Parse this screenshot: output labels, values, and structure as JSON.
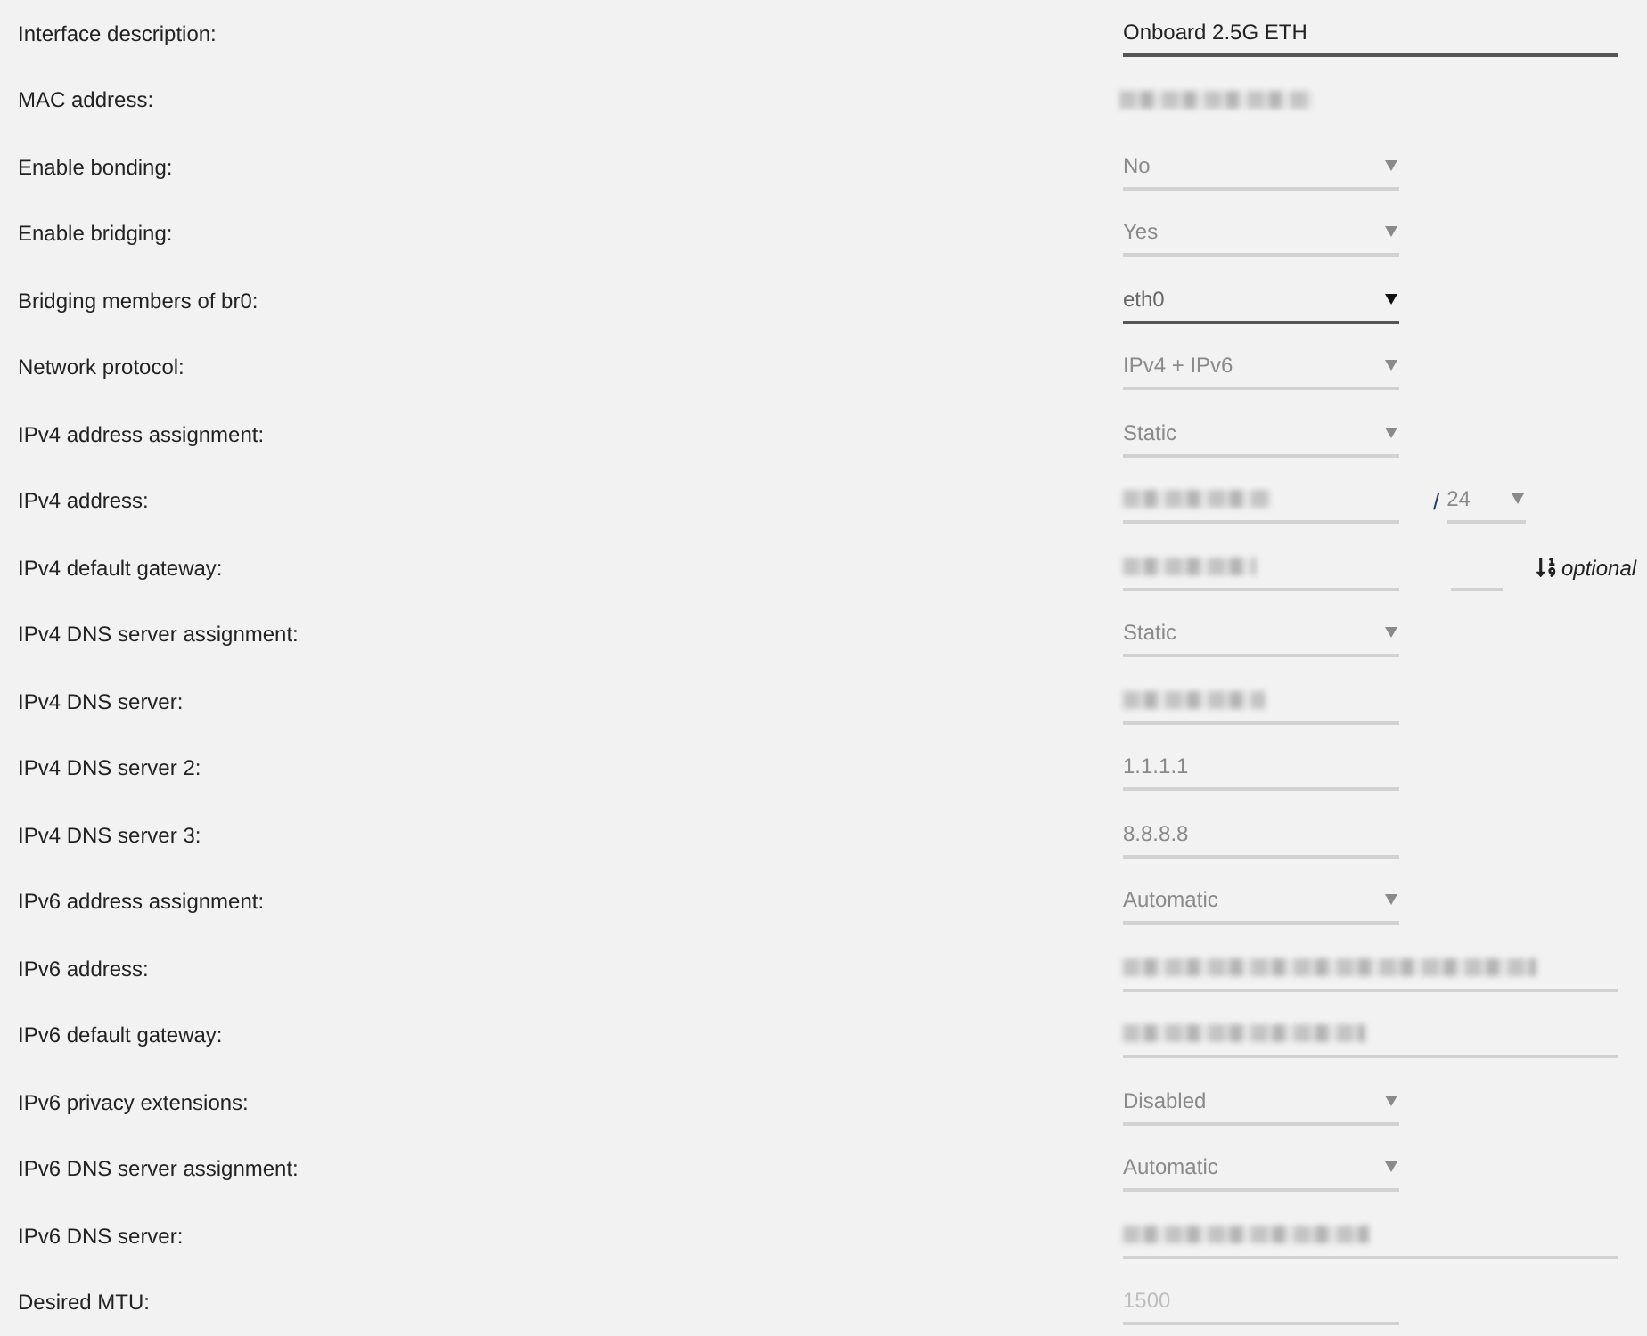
{
  "fields": [
    {
      "label": "Interface description:",
      "kind": "text",
      "value": "Onboard 2.5G ETH",
      "disabled": false,
      "wide": true
    },
    {
      "label": "MAC address:",
      "kind": "static",
      "blurred": true
    },
    {
      "label": "Enable bonding:",
      "kind": "select",
      "value": "No",
      "disabled": true
    },
    {
      "label": "Enable bridging:",
      "kind": "select",
      "value": "Yes",
      "disabled": true
    },
    {
      "label": "Bridging members of br0:",
      "kind": "select",
      "value": "eth0",
      "disabled": false
    },
    {
      "label": "Network protocol:",
      "kind": "select",
      "value": "IPv4 + IPv6",
      "disabled": true
    },
    {
      "label": "IPv4 address assignment:",
      "kind": "select",
      "value": "Static",
      "disabled": true
    },
    {
      "label": "IPv4 address:",
      "kind": "text",
      "blurred": true,
      "disabled": true,
      "prefix": {
        "separator": "/",
        "value": "24",
        "disabled": true
      }
    },
    {
      "label": "IPv4 default gateway:",
      "kind": "text",
      "blurred": true,
      "disabled": true,
      "metric": {
        "disabled": true,
        "hint": "optional"
      }
    },
    {
      "label": "IPv4 DNS server assignment:",
      "kind": "select",
      "value": "Static",
      "disabled": true
    },
    {
      "label": "IPv4 DNS server:",
      "kind": "text",
      "blurred": true,
      "disabled": true
    },
    {
      "label": "IPv4 DNS server 2:",
      "kind": "text",
      "value": "1.1.1.1",
      "disabled": true
    },
    {
      "label": "IPv4 DNS server 3:",
      "kind": "text",
      "value": "8.8.8.8",
      "disabled": true
    },
    {
      "label": "IPv6 address assignment:",
      "kind": "select",
      "value": "Automatic",
      "disabled": true
    },
    {
      "label": "IPv6 address:",
      "kind": "text",
      "blurred": true,
      "disabled": true,
      "wide": true
    },
    {
      "label": "IPv6 default gateway:",
      "kind": "text",
      "blurred": true,
      "disabled": true,
      "wide": true
    },
    {
      "label": "IPv6 privacy extensions:",
      "kind": "select",
      "value": "Disabled",
      "disabled": true
    },
    {
      "label": "IPv6 DNS server assignment:",
      "kind": "select",
      "value": "Automatic",
      "disabled": true
    },
    {
      "label": "IPv6 DNS server:",
      "kind": "text",
      "blurred": true,
      "disabled": true,
      "wide": true
    },
    {
      "label": "Desired MTU:",
      "kind": "text",
      "placeholder": "1500",
      "disabled": true
    }
  ]
}
